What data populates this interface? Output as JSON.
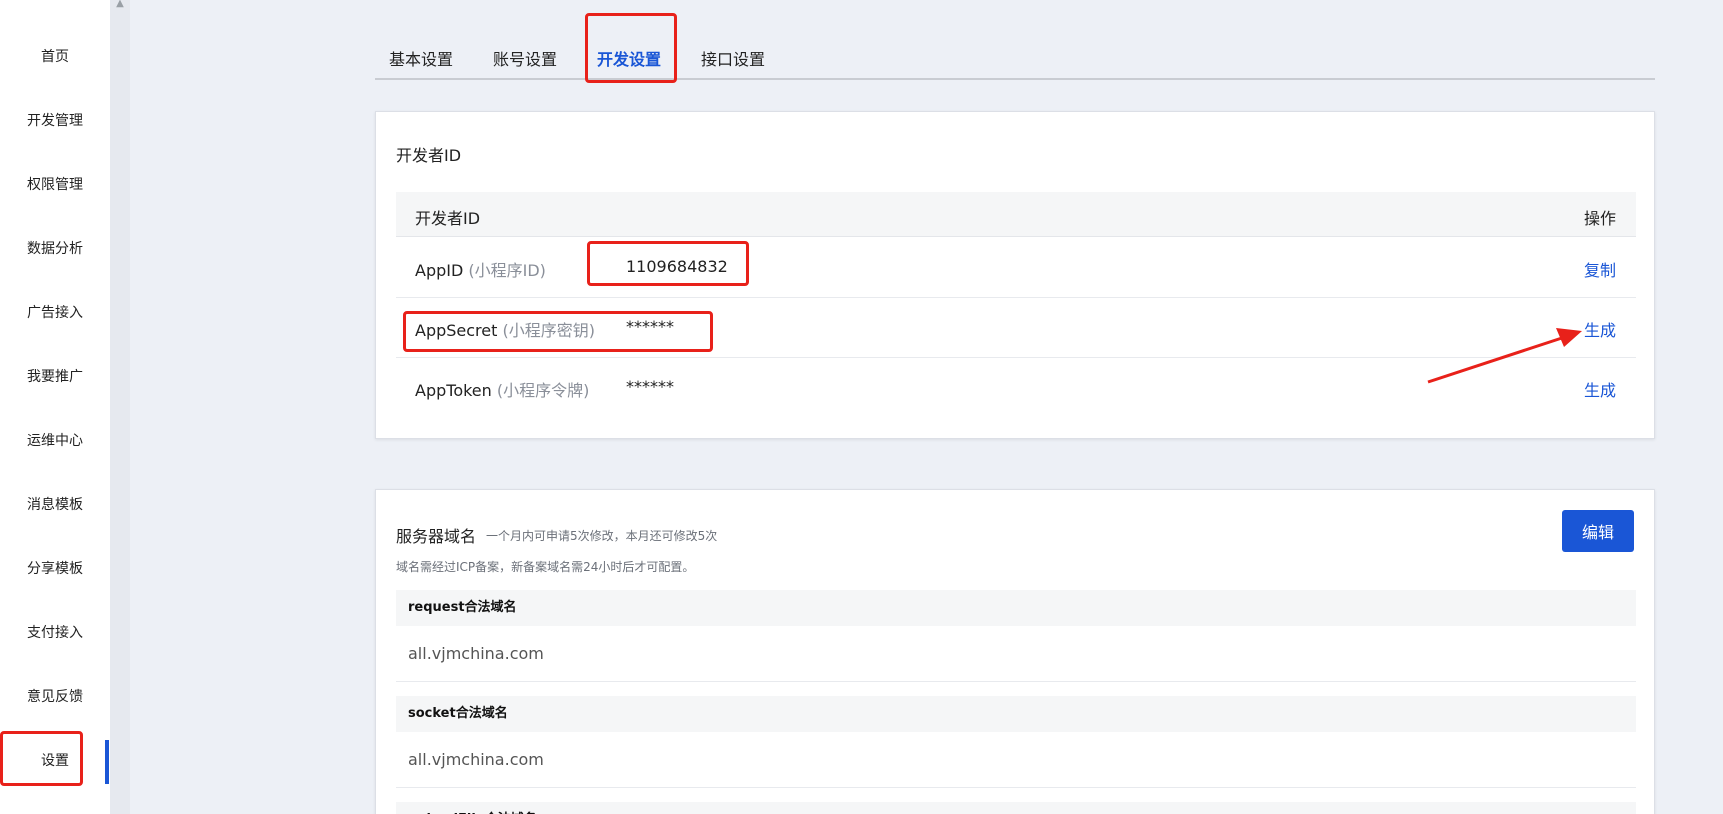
{
  "sidebar": {
    "items": [
      {
        "label": "首页"
      },
      {
        "label": "开发管理"
      },
      {
        "label": "权限管理"
      },
      {
        "label": "数据分析"
      },
      {
        "label": "广告接入"
      },
      {
        "label": "我要推广"
      },
      {
        "label": "运维中心"
      },
      {
        "label": "消息模板"
      },
      {
        "label": "分享模板"
      },
      {
        "label": "支付接入"
      },
      {
        "label": "意见反馈"
      },
      {
        "label": "设置"
      }
    ],
    "active": "设置"
  },
  "tabs": [
    {
      "label": "基本设置"
    },
    {
      "label": "账号设置"
    },
    {
      "label": "开发设置"
    },
    {
      "label": "接口设置"
    }
  ],
  "active_tab": "开发设置",
  "developer_id": {
    "title": "开发者ID",
    "table_headers": {
      "name": "开发者ID",
      "action": "操作"
    },
    "rows": [
      {
        "name": "AppID",
        "hint": "(小程序ID)",
        "value": "1109684832",
        "action": "复制"
      },
      {
        "name": "AppSecret",
        "hint": "(小程序密钥)",
        "value": "******",
        "action": "生成"
      },
      {
        "name": "AppToken",
        "hint": "(小程序令牌)",
        "value": "******",
        "action": "生成"
      }
    ]
  },
  "server_domain": {
    "title": "服务器域名",
    "subtitle": "一个月内可申请5次修改，本月还可修改5次",
    "note": "域名需经过ICP备案，新备案域名需24小时后才可配置。",
    "edit_label": "编辑",
    "domains": [
      {
        "label": "request合法域名",
        "value": "all.vjmchina.com"
      },
      {
        "label": "socket合法域名",
        "value": "all.vjmchina.com"
      },
      {
        "label": "uploadFile合法域名",
        "value": ""
      }
    ]
  },
  "colors": {
    "accent": "#1a56d6",
    "annotation": "#e8211a",
    "background": "#edf0f6"
  }
}
